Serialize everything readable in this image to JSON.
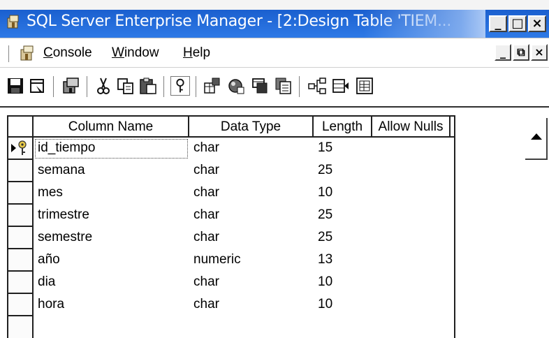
{
  "window": {
    "title": "SQL Server Enterprise Manager - [2:Design Table 'TIEM...",
    "controls": [
      "_",
      "□",
      "×"
    ]
  },
  "menubar": {
    "items": [
      {
        "label": "Console",
        "accel": "C",
        "rest": "onsole"
      },
      {
        "label": "Window",
        "accel": "W",
        "rest": "indow"
      },
      {
        "label": "Help",
        "accel": "H",
        "rest": "elp"
      }
    ],
    "mdi_controls": [
      "_",
      "⧉",
      "×"
    ]
  },
  "toolbar": {
    "buttons": [
      "save-icon",
      "properties-icon",
      "manage-icon",
      "cut-icon",
      "copy-icon",
      "paste-icon",
      "primary-key-icon",
      "manage-indexes-icon",
      "manage-constraints-icon",
      "manage-relationships-icon",
      "generate-script-icon",
      "relationships-icon",
      "insert-column-icon",
      "table-properties-icon"
    ]
  },
  "grid": {
    "columns": [
      "Column Name",
      "Data Type",
      "Length",
      "Allow Nulls"
    ],
    "rows": [
      {
        "name": "id_tiempo",
        "type": "char",
        "length": "15",
        "allow_nulls": "",
        "primary_key": true,
        "current": true
      },
      {
        "name": "semana",
        "type": "char",
        "length": "25",
        "allow_nulls": ""
      },
      {
        "name": "mes",
        "type": "char",
        "length": "10",
        "allow_nulls": ""
      },
      {
        "name": "trimestre",
        "type": "char",
        "length": "25",
        "allow_nulls": ""
      },
      {
        "name": "semestre",
        "type": "char",
        "length": "25",
        "allow_nulls": ""
      },
      {
        "name": "año",
        "type": "numeric",
        "length": "13",
        "allow_nulls": ""
      },
      {
        "name": "dia",
        "type": "char",
        "length": "10",
        "allow_nulls": ""
      },
      {
        "name": "hora",
        "type": "char",
        "length": "10",
        "allow_nulls": ""
      }
    ]
  },
  "colors": {
    "title_bar": "#2f7ae6",
    "title_text": "#ffffff",
    "grid_lines": "#202020",
    "primary_key": "#c8a000"
  }
}
